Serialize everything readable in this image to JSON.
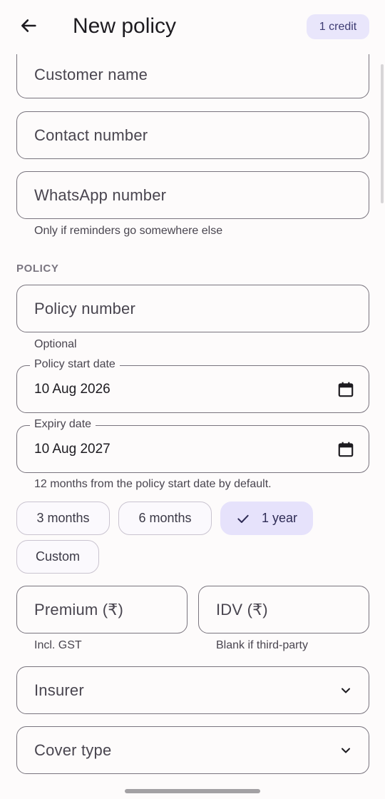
{
  "app_bar": {
    "title": "New policy",
    "credit_badge": "1 credit",
    "back_icon": "arrow-back-icon"
  },
  "customer": {
    "name_placeholder": "Customer name",
    "contact_placeholder": "Contact number",
    "whatsapp_placeholder": "WhatsApp number",
    "whatsapp_helper": "Only if reminders go somewhere else"
  },
  "policy": {
    "section_title": "POLICY",
    "number_placeholder": "Policy number",
    "number_helper": "Optional",
    "start_date_label": "Policy start date",
    "start_date_value": "10 Aug 2026",
    "expiry_date_label": "Expiry date",
    "expiry_date_value": "10 Aug 2027",
    "expiry_helper": "12 months from the policy start date by default.",
    "calendar_icon": "calendar-icon",
    "durations": [
      {
        "label": "3 months",
        "selected": false
      },
      {
        "label": "6 months",
        "selected": false
      },
      {
        "label": "1 year",
        "selected": true
      },
      {
        "label": "Custom",
        "selected": false
      }
    ],
    "premium_placeholder": "Premium (₹)",
    "premium_helper": "Incl. GST",
    "idv_placeholder": "IDV (₹)",
    "idv_helper": "Blank if third-party",
    "insurer_placeholder": "Insurer",
    "cover_type_placeholder": "Cover type",
    "dropdown_icon": "chevron-down-icon"
  },
  "colors": {
    "background": "#fdfbfb",
    "outline": "#79747e",
    "chip_selected": "#e6e2fb",
    "badge": "#e9e6fb"
  }
}
